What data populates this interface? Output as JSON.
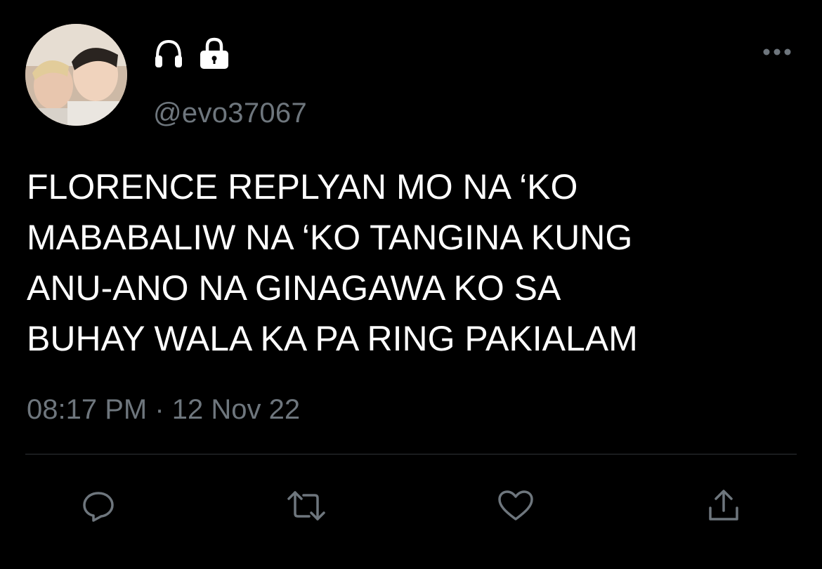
{
  "tweet": {
    "handle": "@evo37067",
    "text_lines": [
      "FLORENCE REPLYAN MO NA ‘KO",
      "MABABALIW NA ‘KO TANGINA KUNG",
      "ANU-ANO NA GINAGAWA KO SA",
      "BUHAY WALA KA PA RING PAKIALAM"
    ],
    "timestamp": "08:17 PM · 12 Nov 22",
    "name_icons": [
      "headphones-icon",
      "lock-icon"
    ]
  },
  "actions": {
    "icons": [
      "reply-icon",
      "retweet-icon",
      "like-icon",
      "share-icon"
    ]
  },
  "colors": {
    "background": "#000000",
    "text": "#ffffff",
    "secondary_text": "#6e767d",
    "divider": "#2f3336"
  }
}
